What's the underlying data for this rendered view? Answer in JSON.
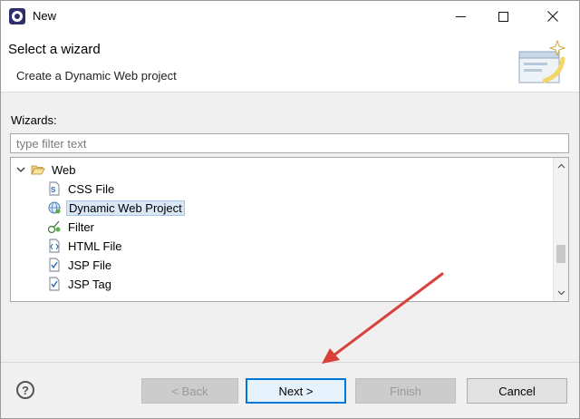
{
  "window": {
    "title": "New"
  },
  "banner": {
    "title": "Select a wizard",
    "description": "Create a Dynamic Web project"
  },
  "wizards": {
    "label": "Wizards:",
    "filter_placeholder": "type filter text",
    "tree": {
      "folder": {
        "label": "Web",
        "icon": "folder-open-icon",
        "expanded": true
      },
      "items": [
        {
          "label": "CSS File",
          "icon": "css-file-icon",
          "selected": false
        },
        {
          "label": "Dynamic Web Project",
          "icon": "globe-project-icon",
          "selected": true
        },
        {
          "label": "Filter",
          "icon": "filter-icon",
          "selected": false
        },
        {
          "label": "HTML File",
          "icon": "html-file-icon",
          "selected": false
        },
        {
          "label": "JSP File",
          "icon": "jsp-file-icon",
          "selected": false
        },
        {
          "label": "JSP Tag",
          "icon": "jsp-tag-icon",
          "selected": false
        }
      ]
    }
  },
  "buttons": {
    "back": "< Back",
    "next": "Next >",
    "finish": "Finish",
    "cancel": "Cancel",
    "help": "?"
  },
  "colors": {
    "selection_bg": "#d8e6f5",
    "default_button_border": "#0078d7",
    "annotation_arrow": "#d9403a"
  }
}
